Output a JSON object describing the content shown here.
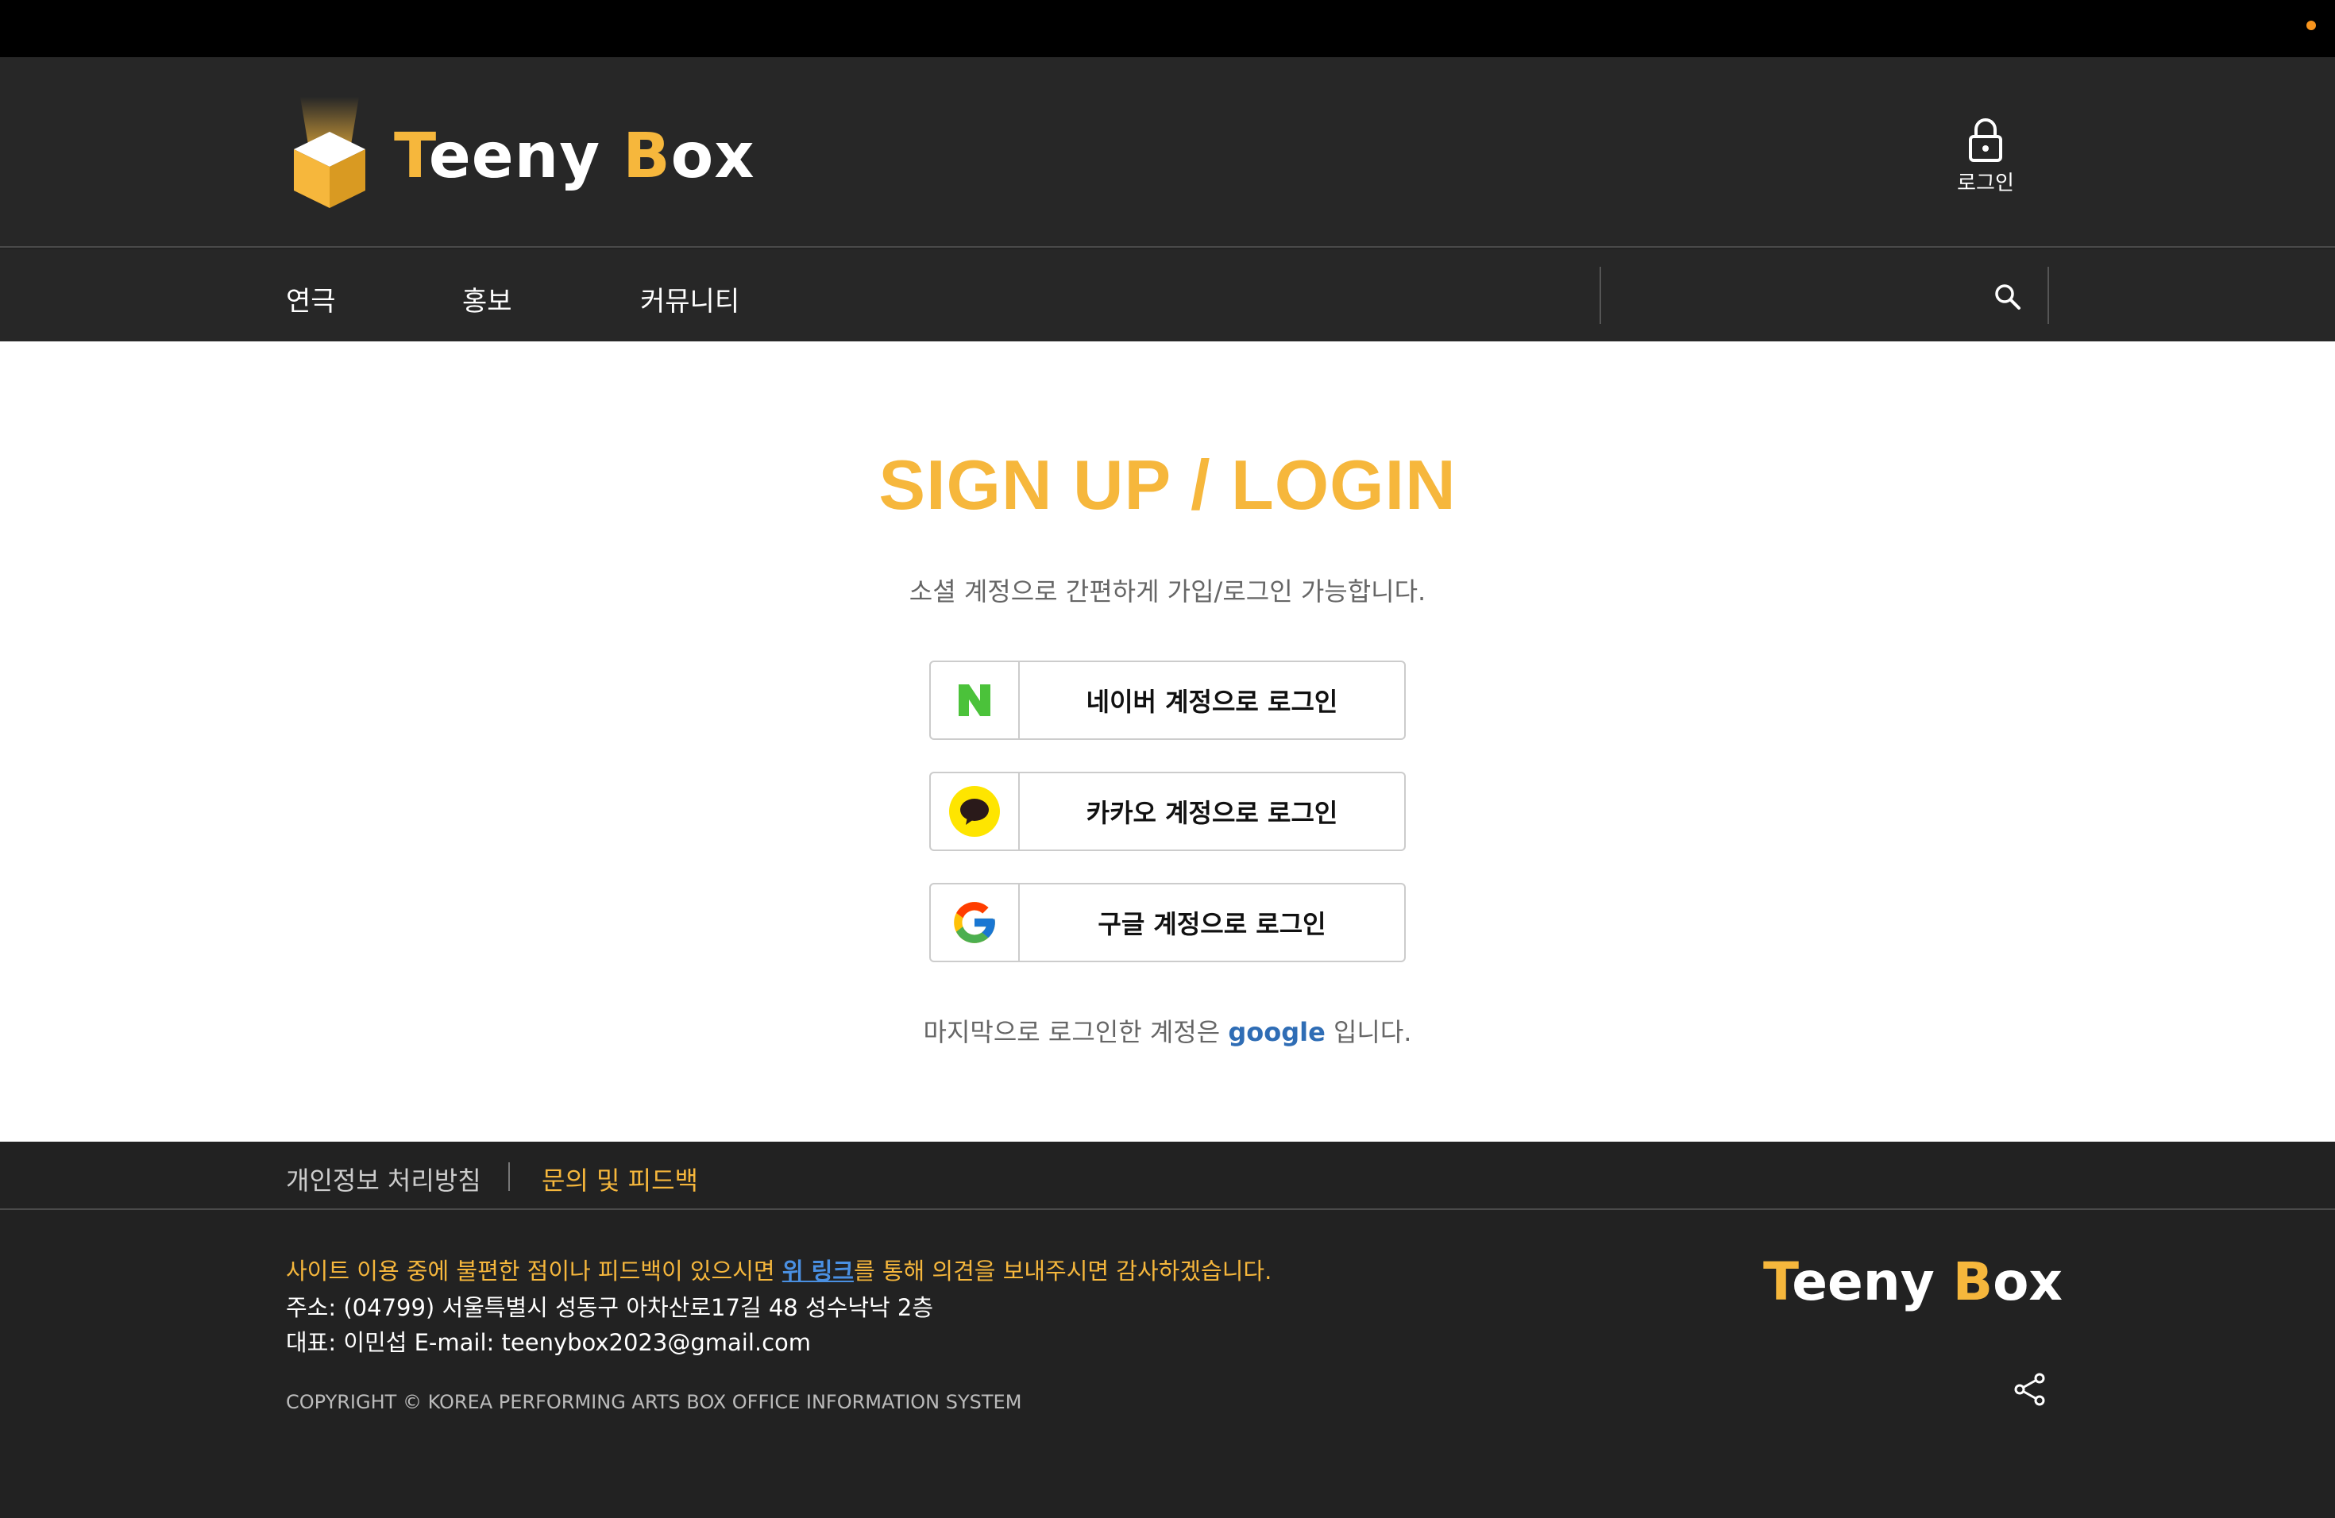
{
  "colors": {
    "accent": "#f6b73c",
    "header_bg": "#272727",
    "footer_bg": "#222222",
    "link_blue": "#2f6db5",
    "naver_green": "#03c75a",
    "kakao_yellow": "#fee500"
  },
  "header": {
    "logo_part1": "T",
    "logo_part2": "eeny ",
    "logo_part3": "B",
    "logo_part4": "ox",
    "login_label": "로그인",
    "login_icon": "lock-icon"
  },
  "nav": {
    "items": [
      {
        "label": "연극"
      },
      {
        "label": "홍보"
      },
      {
        "label": "커뮤니티"
      }
    ],
    "search_icon": "search-icon"
  },
  "main": {
    "title": "SIGN UP / LOGIN",
    "subtitle": "소셜 계정으로 간편하게 가입/로그인 가능합니다.",
    "buttons": [
      {
        "label": "네이버 계정으로 로그인",
        "icon": "naver-icon"
      },
      {
        "label": "카카오 계정으로 로그인",
        "icon": "kakao-icon"
      },
      {
        "label": "구글 계정으로 로그인",
        "icon": "google-icon"
      }
    ],
    "last_login_prefix": "마지막으로 로그인한 계정은",
    "last_login_provider": "google",
    "last_login_suffix": "입니다."
  },
  "footer": {
    "links": [
      {
        "label": "개인정보 처리방침"
      },
      {
        "label": "문의 및 피드백"
      }
    ],
    "feedback_prefix": "사이트 이용 중에 불편한 점이나 피드백이 있으시면 ",
    "feedback_link": "위 링크",
    "feedback_suffix": "를 통해 의견을 보내주시면 감사하겠습니다.",
    "address": "주소: (04799) 서울특별시 성동구 아차산로17길 48 성수낙낙 2층",
    "contact": "대표: 이민섭    E-mail: teenybox2023@gmail.com",
    "copyright": "COPYRIGHT © KOREA PERFORMING ARTS BOX OFFICE INFORMATION SYSTEM",
    "logo_part1": "T",
    "logo_part2": "eeny ",
    "logo_part3": "B",
    "logo_part4": "ox",
    "share_icon": "share-icon"
  }
}
